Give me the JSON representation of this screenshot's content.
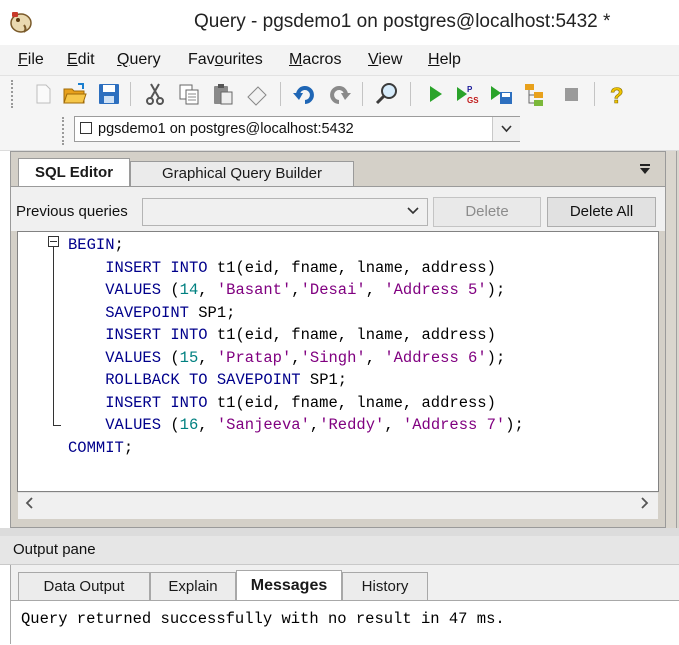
{
  "window": {
    "title": "Query - pgsdemo1 on postgres@localhost:5432 *"
  },
  "menu": [
    {
      "label": "File",
      "accel": "F",
      "rest": "ile"
    },
    {
      "label": "Edit",
      "accel": "E",
      "rest": "dit"
    },
    {
      "label": "Query",
      "accel": "Q",
      "rest": "uery"
    },
    {
      "label": "Favourites",
      "pre": "Fav",
      "accel": "o",
      "rest": "urites"
    },
    {
      "label": "Macros",
      "accel": "M",
      "rest": "acros"
    },
    {
      "label": "View",
      "accel": "V",
      "rest": "iew"
    },
    {
      "label": "Help",
      "accel": "H",
      "rest": "elp"
    }
  ],
  "toolbar": {
    "buttons": [
      "new-file",
      "open-file",
      "save",
      "cut",
      "copy",
      "paste",
      "clear",
      "undo",
      "redo",
      "find",
      "execute",
      "execute-pgscript",
      "execute-to-file",
      "explain",
      "stop",
      "help"
    ]
  },
  "connection": {
    "value": "pgsdemo1 on postgres@localhost:5432"
  },
  "editor": {
    "tabs": [
      "SQL Editor",
      "Graphical Query Builder"
    ],
    "active_tab": "SQL Editor",
    "previous_queries_label": "Previous queries",
    "previous_queries_value": "",
    "delete_label": "Delete",
    "delete_all_label": "Delete All",
    "code_lines": [
      "BEGIN;",
      "    INSERT INTO t1(eid, fname, lname, address)",
      "    VALUES (14, 'Basant','Desai', 'Address 5');",
      "    SAVEPOINT SP1;",
      "    INSERT INTO t1(eid, fname, lname, address)",
      "    VALUES (15, 'Pratap','Singh', 'Address 6');",
      "    ROLLBACK TO SAVEPOINT SP1;",
      "    INSERT INTO t1(eid, fname, lname, address)",
      "    VALUES (16, 'Sanjeeva','Reddy', 'Address 7');",
      "COMMIT;"
    ]
  },
  "output": {
    "title": "Output pane",
    "tabs": [
      "Data Output",
      "Explain",
      "Messages",
      "History"
    ],
    "active_tab": "Messages",
    "message": "Query returned successfully with no result in 47 ms."
  },
  "colors": {
    "keyword": "#00008b",
    "number": "#008080",
    "string": "#800080"
  }
}
